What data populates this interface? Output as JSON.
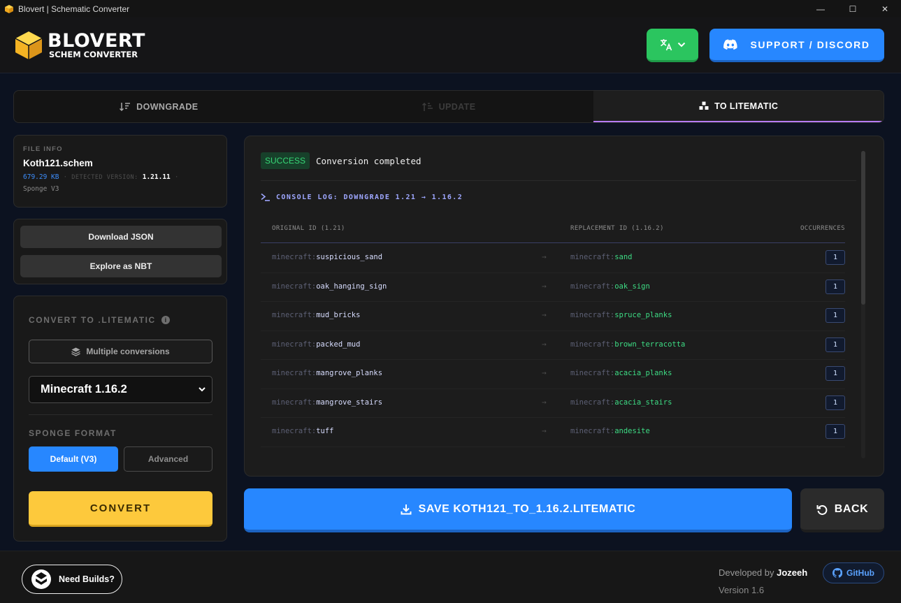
{
  "window": {
    "title": "Blovert | Schematic Converter",
    "minimize_glyph": "—",
    "maximize_glyph": "☐",
    "close_glyph": "✕"
  },
  "header": {
    "logo_title": "BLOVERT",
    "logo_subtitle": "SCHEM CONVERTER",
    "language_icon": "translate-icon",
    "support_label": "SUPPORT / DISCORD"
  },
  "tabs": [
    {
      "label": "DOWNGRADE",
      "icon": "sort-down-icon",
      "state": "normal"
    },
    {
      "label": "UPDATE",
      "icon": "sort-up-icon",
      "state": "disabled"
    },
    {
      "label": "TO LITEMATIC",
      "icon": "cubes-icon",
      "state": "active"
    }
  ],
  "file_info": {
    "label": "FILE INFO",
    "name": "Koth121.schem",
    "size": "679.29 KB",
    "detected_label": "DETECTED VERSION:",
    "detected_version": "1.21.11",
    "format": "Sponge V3",
    "separator": "·"
  },
  "actions": {
    "download_json": "Download JSON",
    "explore_nbt": "Explore as NBT"
  },
  "convert": {
    "title": "CONVERT TO .LITEMATIC",
    "info_glyph": "i",
    "multiple_label": "Multiple conversions",
    "target_version": "Minecraft 1.16.2",
    "sponge_label": "SPONGE FORMAT",
    "format_default": "Default (V3)",
    "format_advanced": "Advanced",
    "convert_label": "CONVERT"
  },
  "console": {
    "status_badge": "SUCCESS",
    "status_text": "Conversion completed",
    "log_title": "CONSOLE LOG: DOWNGRADE 1.21 → 1.16.2",
    "col_original": "ORIGINAL ID (1.21)",
    "col_replacement": "REPLACEMENT ID (1.16.2)",
    "col_occurrences": "OCCURRENCES",
    "namespace": "minecraft:",
    "arrow": "→",
    "rows": [
      {
        "original": "suspicious_sand",
        "replacement": "sand",
        "count": "1"
      },
      {
        "original": "oak_hanging_sign",
        "replacement": "oak_sign",
        "count": "1"
      },
      {
        "original": "mud_bricks",
        "replacement": "spruce_planks",
        "count": "1"
      },
      {
        "original": "packed_mud",
        "replacement": "brown_terracotta",
        "count": "1"
      },
      {
        "original": "mangrove_planks",
        "replacement": "acacia_planks",
        "count": "1"
      },
      {
        "original": "mangrove_stairs",
        "replacement": "acacia_stairs",
        "count": "1"
      },
      {
        "original": "tuff",
        "replacement": "andesite",
        "count": "1"
      }
    ]
  },
  "save_label": "SAVE KOTH121_TO_1.16.2.LITEMATIC",
  "back_label": "BACK",
  "footer": {
    "need_builds": "Need Builds?",
    "developed_by": "Developed by",
    "developer": "Jozeeh",
    "github_label": "GitHub",
    "version": "Version 1.6"
  },
  "colors": {
    "accent_blue": "#2787ff",
    "success_green": "#37d676",
    "convert_yellow": "#fdc93c",
    "tab_active_underline": "#b67cf3"
  }
}
